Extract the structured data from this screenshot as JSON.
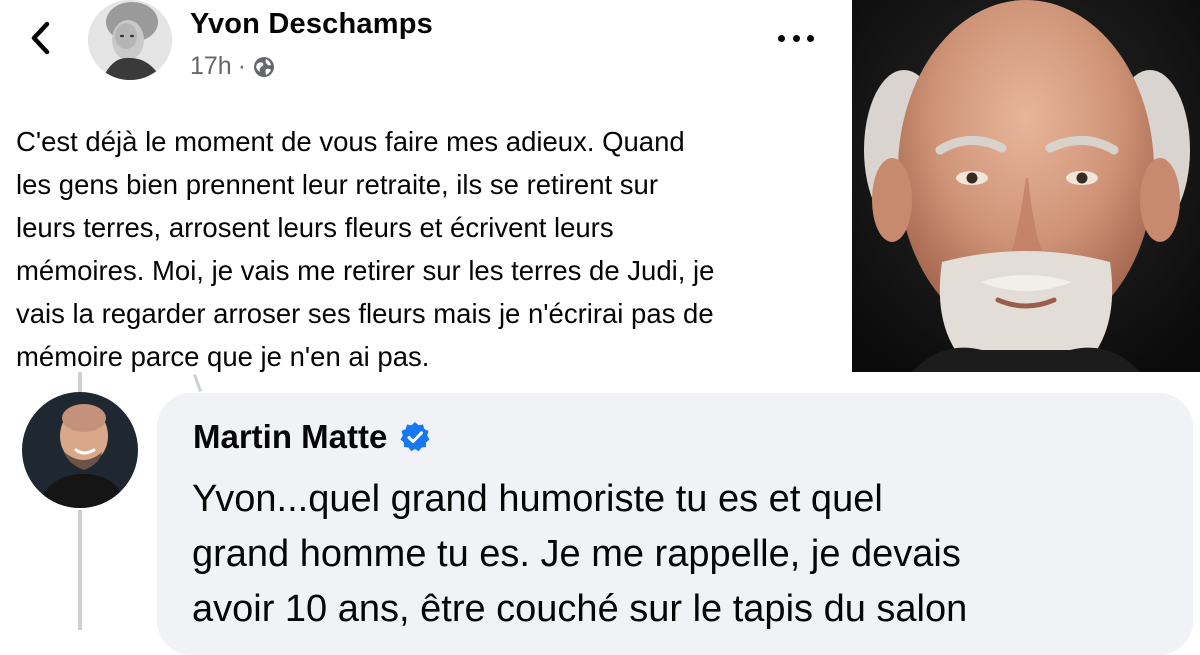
{
  "post": {
    "author_name": "Yvon Deschamps",
    "timestamp": "17h",
    "separator": "·",
    "audience_icon": "globe-icon",
    "back_icon": "chevron-left-icon",
    "more_icon": "more-options-icon",
    "text_lines": [
      "C'est déjà le moment de vous faire mes adieux. Quand",
      "les gens bien prennent leur retraite, ils se retirent sur",
      "leurs terres, arrosent leurs fleurs et écrivent leurs",
      "mémoires. Moi, je vais me retirer sur les terres de Judi, je",
      "vais la regarder arroser ses fleurs mais je n'écrirai pas de",
      "mémoire parce que je n'en ai pas."
    ]
  },
  "comment": {
    "author_name": "Martin Matte",
    "verified_icon": "verified-badge-icon",
    "text_lines": [
      "Yvon...quel grand humoriste tu es et quel",
      "grand homme tu es. Je me rappelle, je devais",
      "avoir 10 ans, être couché sur le tapis du salon"
    ]
  },
  "colors": {
    "text_primary": "#050505",
    "text_secondary": "#65676b",
    "comment_bubble": "#f0f2f5",
    "verified_blue": "#1877f2",
    "thread_line": "#ccd0d5"
  }
}
